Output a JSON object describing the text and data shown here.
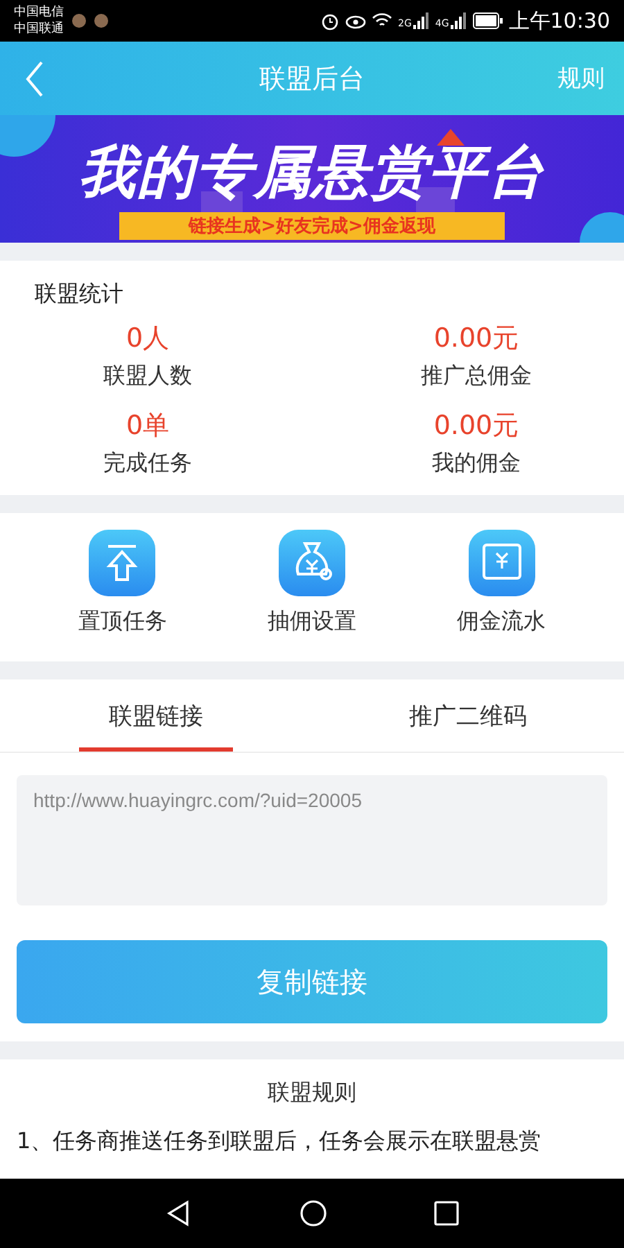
{
  "status_bar": {
    "carriers": [
      "中国电信",
      "中国联通"
    ],
    "networks": [
      "2G",
      "4G"
    ],
    "time": "上午10:30"
  },
  "header": {
    "title": "联盟后台",
    "action": "规则"
  },
  "banner": {
    "headline": "我的专属悬赏平台",
    "subline": "链接生成>好友完成>佣金返现"
  },
  "stats": {
    "title": "联盟统计",
    "items": [
      {
        "value": "0人",
        "label": "联盟人数"
      },
      {
        "value": "0.00元",
        "label": "推广总佣金"
      },
      {
        "value": "0单",
        "label": "完成任务"
      },
      {
        "value": "0.00元",
        "label": "我的佣金"
      }
    ]
  },
  "actions": [
    {
      "kind": "top",
      "label": "置顶任务"
    },
    {
      "kind": "bag",
      "label": "抽佣设置"
    },
    {
      "kind": "flow",
      "label": "佣金流水"
    }
  ],
  "tabs": [
    {
      "label": "联盟链接",
      "selected": true
    },
    {
      "label": "推广二维码",
      "selected": false
    }
  ],
  "link_field": {
    "value": "http://www.huayingrc.com/?uid=20005"
  },
  "copy_button": "复制链接",
  "rules": {
    "title": "联盟规则",
    "text": "1、任务商推送任务到联盟后，任务会展示在联盟悬赏"
  }
}
